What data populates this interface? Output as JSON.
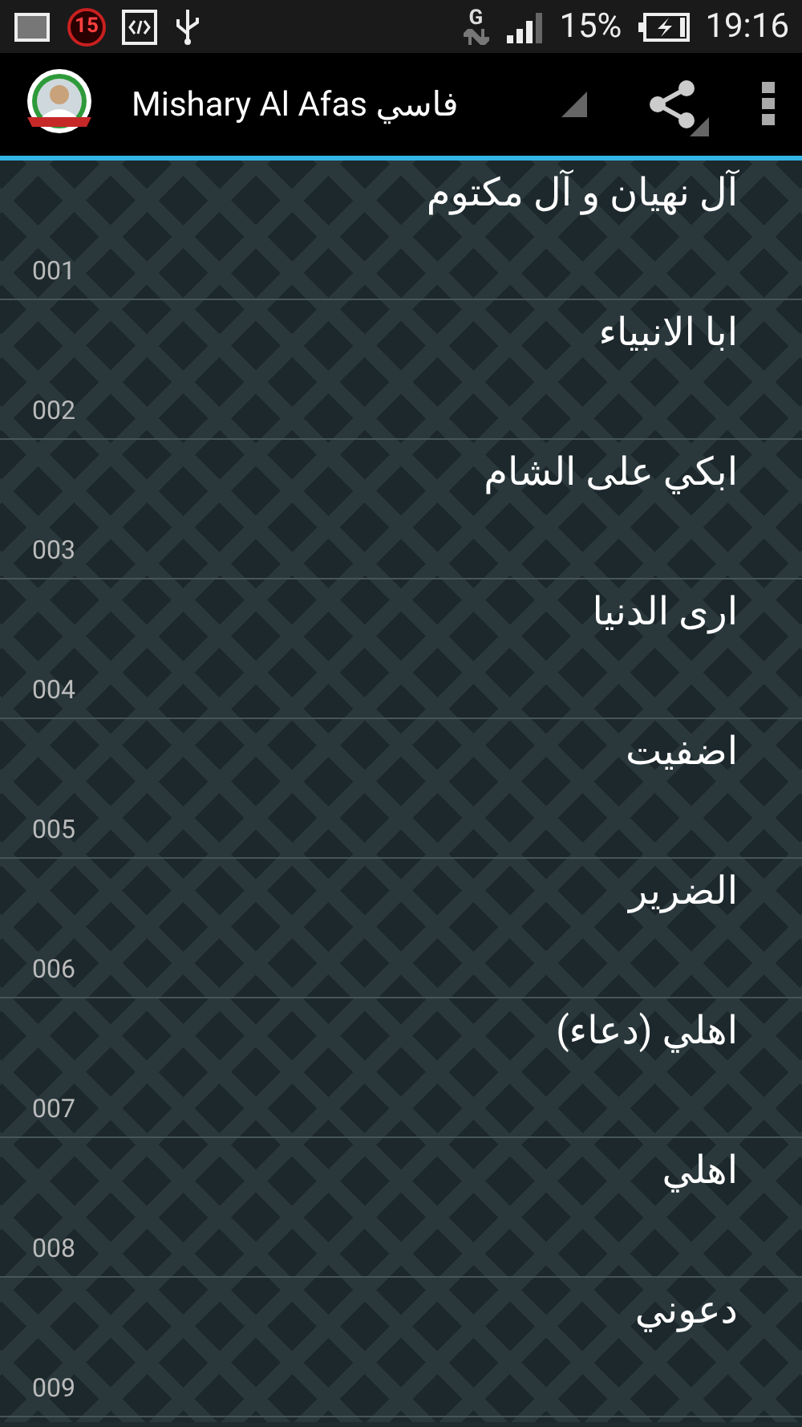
{
  "status_bar": {
    "notification_count": "15",
    "network_type": "G",
    "battery": "15%",
    "time": "19:16"
  },
  "action_bar": {
    "title": "Mishary Al Afas فاسي"
  },
  "tracks": [
    {
      "title": "آل نهيان و آل مكتوم",
      "number": "001"
    },
    {
      "title": "ابا الانبياء",
      "number": "002"
    },
    {
      "title": "ابكي على الشام",
      "number": "003"
    },
    {
      "title": "ارى الدنيا",
      "number": "004"
    },
    {
      "title": "اضفيت",
      "number": "005"
    },
    {
      "title": "الضرير",
      "number": "006"
    },
    {
      "title": "اهلي (دعاء)",
      "number": "007"
    },
    {
      "title": "اهلي",
      "number": "008"
    },
    {
      "title": "دعوني",
      "number": "009"
    }
  ]
}
